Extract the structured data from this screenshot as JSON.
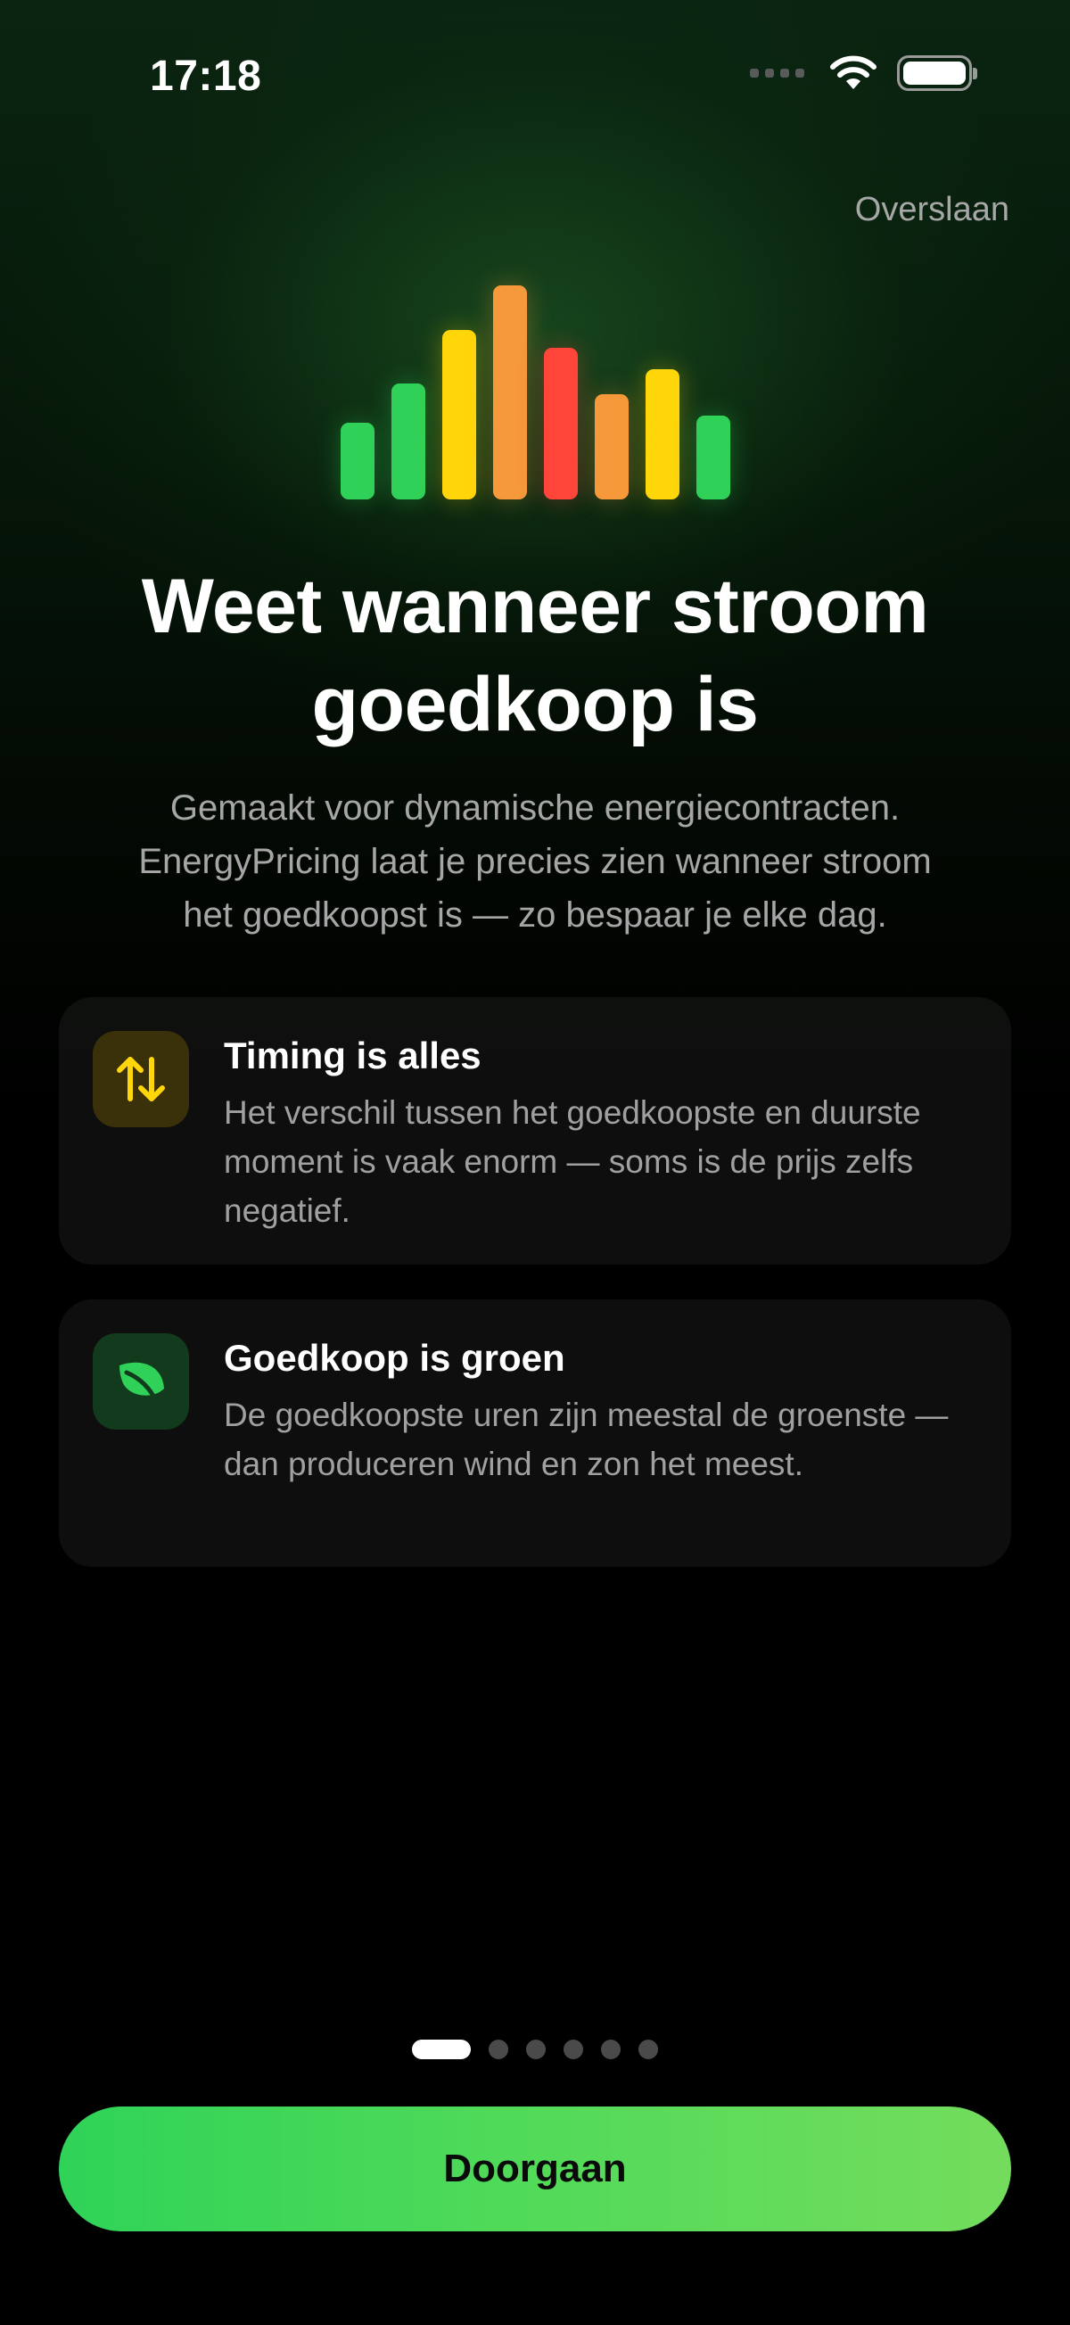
{
  "status_bar": {
    "time": "17:18",
    "icons": [
      "cellular-signal-icon",
      "wifi-icon",
      "battery-icon"
    ]
  },
  "header": {
    "skip_label": "Overslaan"
  },
  "illustration": {
    "icon": "price-bars-icon",
    "bars": [
      {
        "level": 0.36,
        "color": "#30d158"
      },
      {
        "level": 0.54,
        "color": "#30d158"
      },
      {
        "level": 0.79,
        "color": "#ffd60a"
      },
      {
        "level": 1.0,
        "color": "#f5993a"
      },
      {
        "level": 0.71,
        "color": "#ff453a"
      },
      {
        "level": 0.49,
        "color": "#f5993a"
      },
      {
        "level": 0.61,
        "color": "#ffd60a"
      },
      {
        "level": 0.39,
        "color": "#30d158"
      }
    ]
  },
  "onboarding": {
    "title_line1": "Weet wanneer stroom",
    "title_line2": "goedkoop is",
    "subtitle_line1": "Gemaakt voor dynamische energiecontracten.",
    "subtitle_line2": "EnergyPricing laat je precies zien wanneer stroom",
    "subtitle_line3": "het goedkoopst is — zo bespaar je elke dag."
  },
  "cards": [
    {
      "icon": "arrows-up-down-icon",
      "icon_color": "#ffd60a",
      "title": "Timing is alles",
      "text": "Het verschil tussen het goedkoopste en duurste moment is vaak enorm — soms is de prijs zelfs negatief."
    },
    {
      "icon": "leaf-icon",
      "icon_color": "#30d158",
      "title": "Goedkoop is groen",
      "text": "De goedkoopste uren zijn meestal de groenste — dan produceren wind en zon het meest."
    }
  ],
  "pager": {
    "total_pages": 6,
    "current_page": 1
  },
  "cta": {
    "label": "Doorgaan"
  },
  "colors": {
    "accent": "#30d158",
    "warning": "#ffd60a",
    "orange": "#f5993a",
    "red": "#ff453a"
  }
}
